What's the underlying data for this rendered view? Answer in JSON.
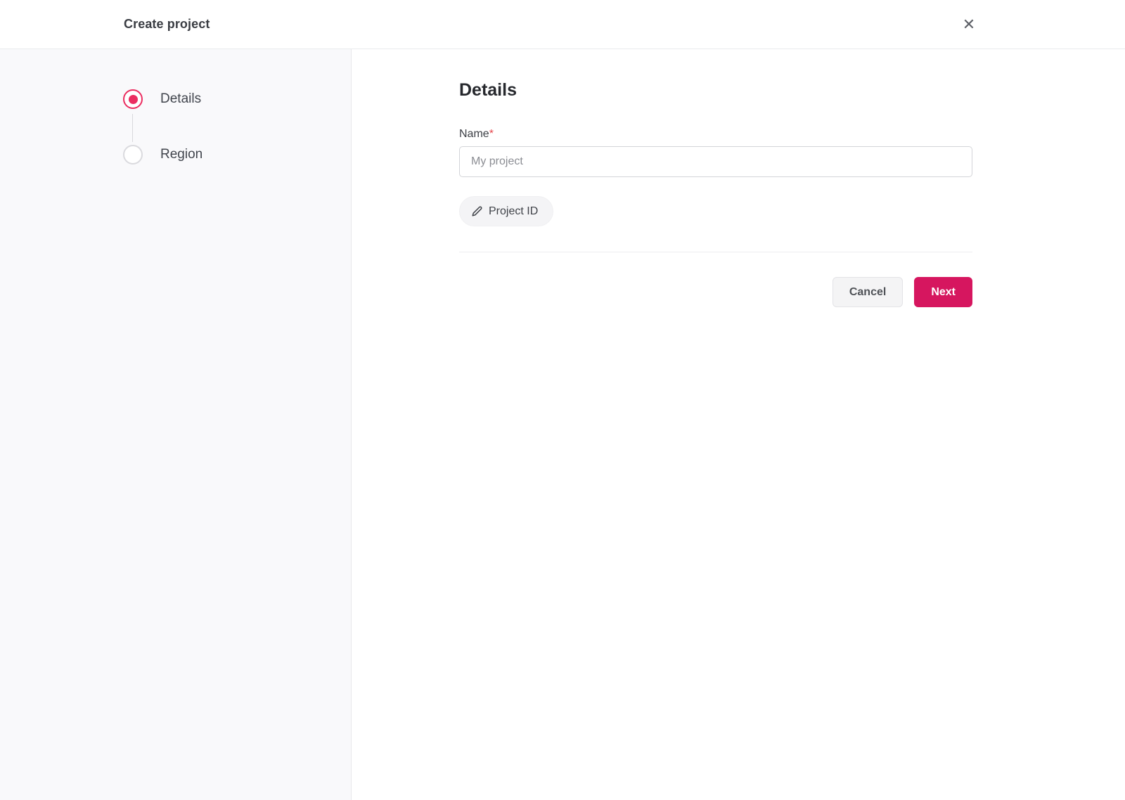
{
  "header": {
    "title": "Create project",
    "close_icon": "✕"
  },
  "stepper": {
    "steps": [
      {
        "label": "Details",
        "state": "active"
      },
      {
        "label": "Region",
        "state": "inactive"
      }
    ]
  },
  "main": {
    "heading": "Details",
    "name_field": {
      "label": "Name",
      "required_marker": "*",
      "placeholder": "My project",
      "value": ""
    },
    "project_id_button": {
      "label": "Project ID",
      "icon": "pencil-icon"
    },
    "actions": {
      "cancel_label": "Cancel",
      "next_label": "Next"
    }
  },
  "colors": {
    "accent_pink": "#d6165f",
    "stepper_active_pink": "#eb2d60",
    "required_red": "#e5484d",
    "sidebar_bg": "#f9f9fb"
  }
}
